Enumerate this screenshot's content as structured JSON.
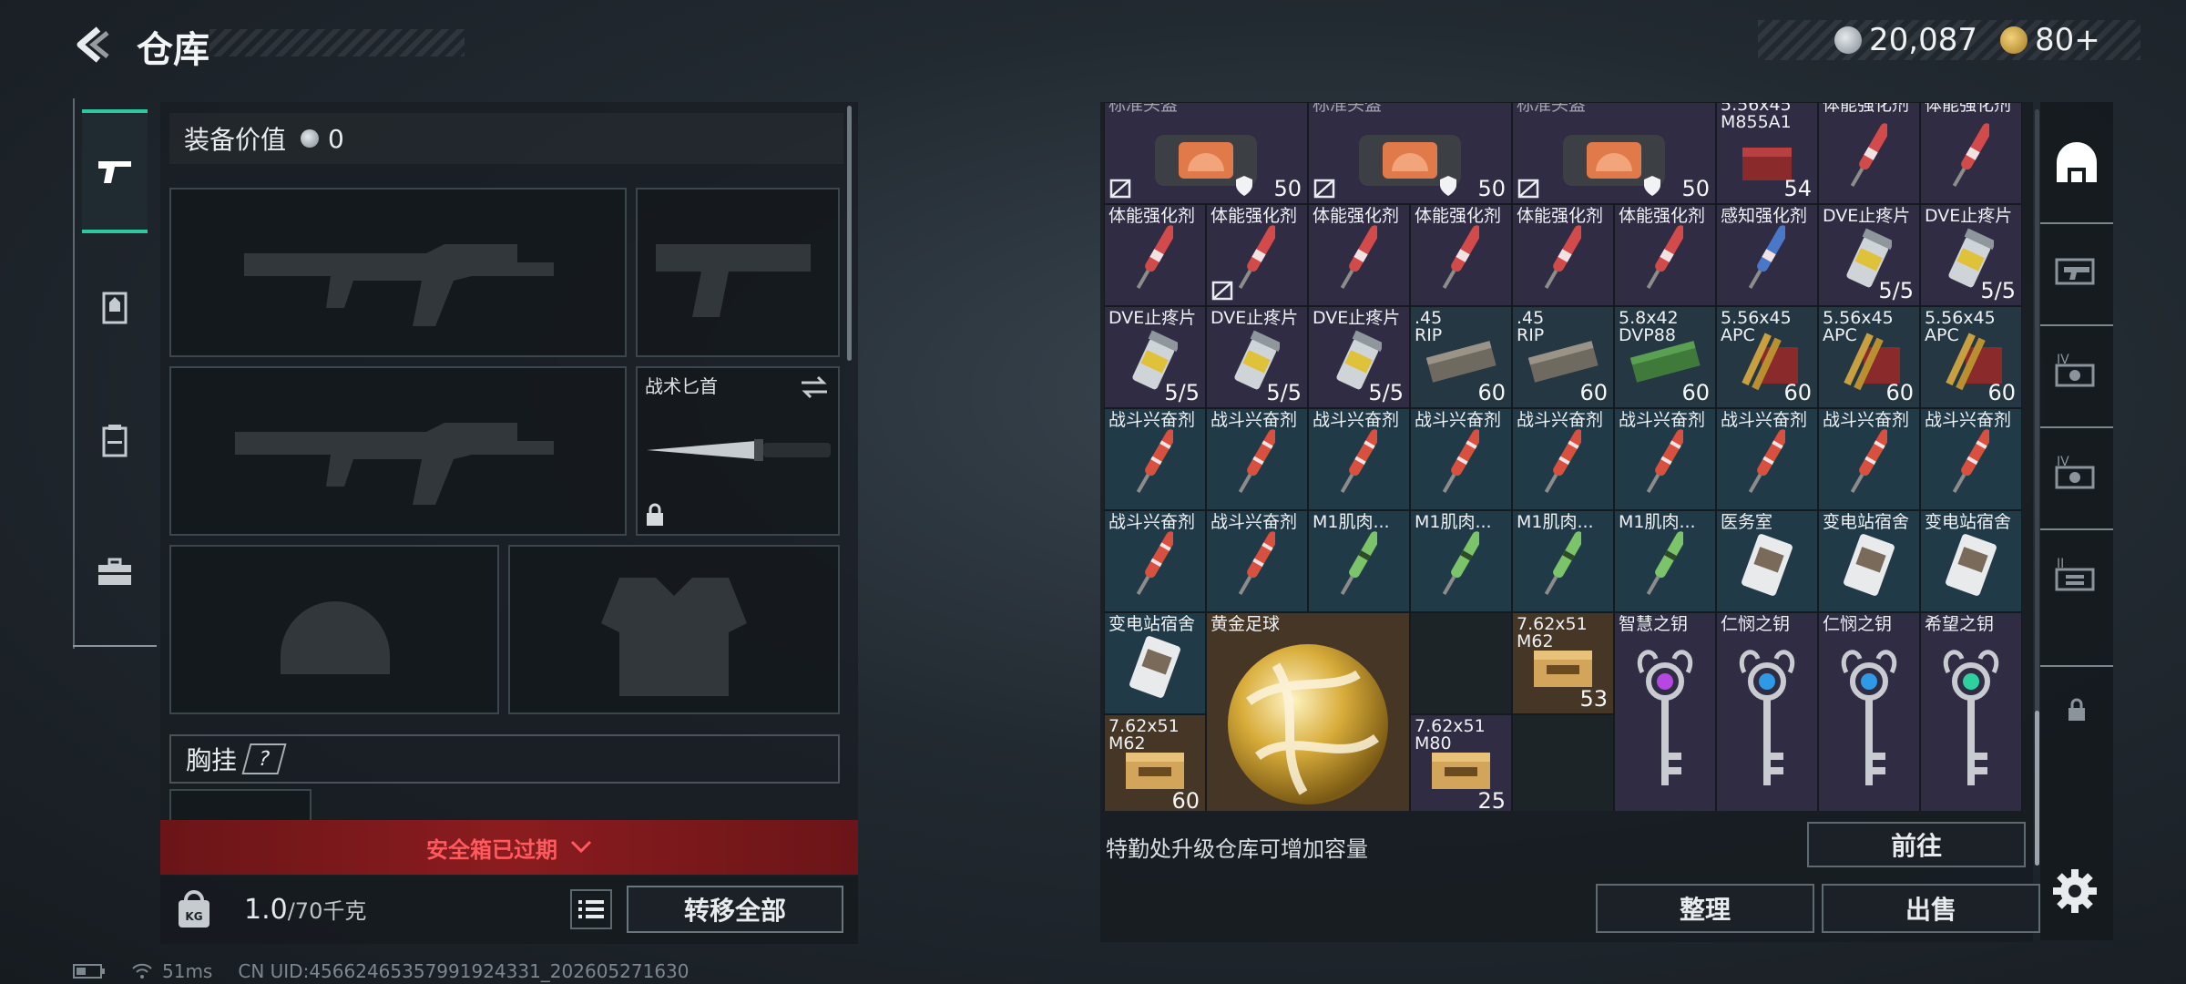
{
  "header": {
    "title": "仓库"
  },
  "currency": {
    "coins": "20,087",
    "tokens": "80+"
  },
  "equipment": {
    "value_label": "装备价值",
    "value": "0",
    "knife_label": "战术匕首",
    "chest_label": "胸挂",
    "chest_help": "?",
    "safebox_status": "安全箱已过期",
    "weight_current": "1.0",
    "weight_max": "/70千克",
    "transfer_all": "转移全部",
    "weight_icon_text": "KG"
  },
  "storage": {
    "upgrade_hint": "特勤处升级仓库可增加容量",
    "goto_label": "前往",
    "sort_label": "整理",
    "sell_label": "出售",
    "cells": {
      "r0c0": {
        "name": "标准头盔",
        "qty": "50"
      },
      "r0c2": {
        "name": "标准头盔",
        "qty": "50"
      },
      "r0c4": {
        "name": "标准头盔",
        "qty": "50"
      },
      "r0c6": {
        "name": "5.56x45",
        "name2": "M855A1",
        "qty": "54"
      },
      "r0c7": {
        "name": "体能强化剂"
      },
      "r0c8": {
        "name": "体能强化剂"
      },
      "r1c0": {
        "name": "体能强化剂"
      },
      "r1c1": {
        "name": "体能强化剂"
      },
      "r1c2": {
        "name": "体能强化剂"
      },
      "r1c3": {
        "name": "体能强化剂"
      },
      "r1c4": {
        "name": "体能强化剂"
      },
      "r1c5": {
        "name": "体能强化剂"
      },
      "r1c6": {
        "name": "感知强化剂"
      },
      "r1c7": {
        "name": "DVE止疼片",
        "qty": "5/5"
      },
      "r1c8": {
        "name": "DVE止疼片",
        "qty": "5/5"
      },
      "r2c0": {
        "name": "DVE止疼片",
        "qty": "5/5"
      },
      "r2c1": {
        "name": "DVE止疼片",
        "qty": "5/5"
      },
      "r2c2": {
        "name": "DVE止疼片",
        "qty": "5/5"
      },
      "r2c3": {
        "name": ".45",
        "name2": "RIP",
        "qty": "60"
      },
      "r2c4": {
        "name": ".45",
        "name2": "RIP",
        "qty": "60"
      },
      "r2c5": {
        "name": "5.8x42",
        "name2": "DVP88",
        "qty": "60"
      },
      "r2c6": {
        "name": "5.56x45",
        "name2": "APC",
        "qty": "60"
      },
      "r2c7": {
        "name": "5.56x45",
        "name2": "APC",
        "qty": "60"
      },
      "r2c8": {
        "name": "5.56x45",
        "name2": "APC",
        "qty": "60"
      },
      "r3": {
        "name": "战斗兴奋剂"
      },
      "r4c0": {
        "name": "战斗兴奋剂"
      },
      "r4c1": {
        "name": "战斗兴奋剂"
      },
      "r4c2": {
        "name": "M1肌肉..."
      },
      "r4c3": {
        "name": "M1肌肉..."
      },
      "r4c4": {
        "name": "M1肌肉..."
      },
      "r4c5": {
        "name": "M1肌肉..."
      },
      "r4c6": {
        "name": "医务室"
      },
      "r4c7": {
        "name": "变电站宿舍"
      },
      "r4c8": {
        "name": "变电站宿舍"
      },
      "r5c0": {
        "name": "变电站宿舍"
      },
      "r5c1": {
        "name": "黄金足球"
      },
      "r5c3": {
        "name": "7.62x51",
        "name2": "M62",
        "qty": "53"
      },
      "r5c4": {
        "name": "智慧之钥"
      },
      "r5c5": {
        "name": "仁悯之钥"
      },
      "r5c6": {
        "name": "仁悯之钥"
      },
      "r5c7": {
        "name": "希望之钥"
      },
      "r5c8": {
        "name": "7.62x51",
        "name2": "M62",
        "qty": "60"
      },
      "r6c0": {
        "name": "7.62x51",
        "name2": "M80",
        "qty": "25"
      }
    }
  },
  "status": {
    "ping": "51ms",
    "uid": "CN UID:456624653579919243​31_202605271630"
  },
  "colors": {
    "accent": "#2fc89c",
    "alert": "#ff5a5e",
    "gold": "#d4a93c"
  }
}
